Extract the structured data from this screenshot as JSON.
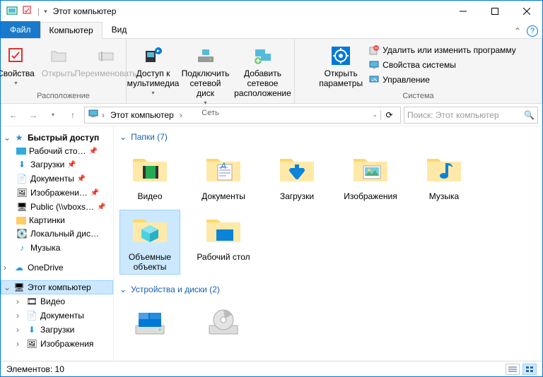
{
  "window": {
    "title": "Этот компьютер"
  },
  "tabs": {
    "file": "Файл",
    "computer": "Компьютер",
    "view": "Вид"
  },
  "ribbon": {
    "location": {
      "label": "Расположение",
      "properties": "Свойства",
      "open": "Открыть",
      "rename": "Переименовать"
    },
    "network": {
      "label": "Сеть",
      "media": "Доступ к мультимедиа",
      "mapdrive": "Подключить сетевой диск",
      "addloc": "Добавить сетевое расположение"
    },
    "system": {
      "label": "Система",
      "settings": "Открыть параметры",
      "uninstall": "Удалить или изменить программу",
      "sysprops": "Свойства системы",
      "manage": "Управление"
    }
  },
  "address": {
    "crumb": "Этот компьютер"
  },
  "search": {
    "placeholder": "Поиск: Этот компьютер"
  },
  "tree": {
    "quick": "Быстрый доступ",
    "items": [
      "Рабочий сто…",
      "Загрузки",
      "Документы",
      "Изображени…",
      "Public (\\\\vboxs…",
      "Картинки",
      "Локальный дис…",
      "Музыка"
    ],
    "onedrive": "OneDrive",
    "thispc": "Этот компьютер",
    "pcitems": [
      "Видео",
      "Документы",
      "Загрузки",
      "Изображения"
    ]
  },
  "sections": {
    "folders": "Папки (7)",
    "devices": "Устройства и диски (2)"
  },
  "folders": [
    {
      "label": "Видео"
    },
    {
      "label": "Документы"
    },
    {
      "label": "Загрузки"
    },
    {
      "label": "Изображения"
    },
    {
      "label": "Музыка"
    },
    {
      "label": "Объемные объекты"
    },
    {
      "label": "Рабочий стол"
    }
  ],
  "status": {
    "count": "Элементов: 10"
  }
}
